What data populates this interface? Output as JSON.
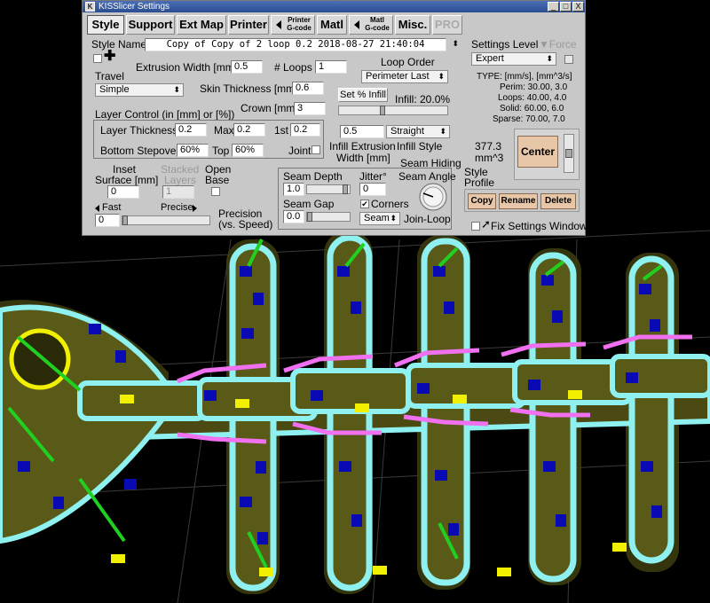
{
  "window": {
    "title": "KISSlicer Settings",
    "minimize_glyph": "_",
    "maximize_glyph": "□",
    "close_glyph": "X"
  },
  "tabs": {
    "style": "Style",
    "support": "Support",
    "ext_map": "Ext Map",
    "printer": "Printer",
    "printer_gcode_1": "Printer",
    "printer_gcode_2": "G-code",
    "matl": "Matl",
    "matl_gcode_1": "Matl",
    "matl_gcode_2": "G-code",
    "misc": "Misc.",
    "pro": "PRO"
  },
  "style": {
    "name_label": "Style Name",
    "name_value": "Copy of Copy of 2 loop 0.2  2018-08-27 21:40:04",
    "extrusion_width_label": "Extrusion Width [mm]",
    "extrusion_width_value": "0.5",
    "loops_label": "# Loops",
    "loops_value": "1",
    "loop_order_label": "Loop Order",
    "loop_order_value": "Perimeter Last",
    "travel_label": "Travel",
    "travel_value": "Simple",
    "skin_thickness_label": "Skin Thickness [mm]",
    "skin_thickness_value": "0.6",
    "set_infill_button": "Set % Infill",
    "infill_label": "Infill: 20.0%",
    "infill_fraction": 0.2,
    "layer_control_label": "Layer Control (in [mm] or [%])",
    "crown_label": "Crown [mm]",
    "crown_value": "3",
    "layer_thickness_label": "Layer Thickness",
    "layer_thickness_value": "0.2",
    "max_label": "Max",
    "max_value": "0.2",
    "first_label": "1st",
    "first_value": "0.2",
    "bottom_stepover_label": "Bottom Stepover",
    "bottom_stepover_value": "60%",
    "top_label": "Top",
    "top_value": "60%",
    "joint_label": "Joint",
    "infill_extrusion_width_label_1": "Infill Extrusion",
    "infill_extrusion_width_label_2": "Width [mm]",
    "infill_extrusion_width_value": "0.5",
    "infill_style_label": "Infill Style",
    "infill_style_value": "Straight",
    "inset_surface_label_1": "Inset",
    "inset_surface_label_2": "Surface [mm]",
    "inset_surface_value": "0",
    "stacked_layers_label_1": "Stacked",
    "stacked_layers_label_2": "Layers",
    "stacked_layers_value": "1",
    "open_base_label_1": "Open",
    "open_base_label_2": "Base",
    "fast_label": "Fast",
    "precise_label": "Precise",
    "precision_value": "0",
    "precision_label_1": "Precision",
    "precision_label_2": "(vs. Speed)",
    "seam_hiding_label": "Seam Hiding",
    "seam_depth_label": "Seam Depth",
    "seam_depth_value": "1.0",
    "jitter_label": "Jitter°",
    "jitter_value": "0",
    "seam_angle_label": "Seam Angle",
    "seam_gap_label": "Seam Gap",
    "seam_gap_value": "0.0",
    "corners_label": "Corners",
    "corners_checked": true,
    "seam_mode_value": "Seam",
    "join_loop_label": "Join-Loop",
    "check_glyph": "✔"
  },
  "settings": {
    "level_label": "Settings Level",
    "force_label": "Force",
    "level_value": "Expert",
    "type_label": "TYPE: [mm/s], [mm^3/s]",
    "perim_line": "Perim:  30.00,  3.0",
    "loops_line": "Loops:  40.00,  4.0",
    "solid_line": "Solid:  60.00,  6.0",
    "sparse_line": "Sparse:  70.00,  7.0",
    "volume_line1": "377.3",
    "volume_line2": "mm^3",
    "center_button": "Center",
    "style_profile_1": "Style",
    "style_profile_2": "Profile",
    "copy_button": "Copy",
    "rename_button": "Rename",
    "delete_button": "Delete",
    "fix_settings_label": "Fix Settings Window"
  },
  "colors": {
    "background": "#000000",
    "window": "#c8c8c8",
    "titlebar": "#2b4c91",
    "outer_shell": "#8ff0f0",
    "part_fill": "#5a5a18",
    "infill_blue": "#0a0ab4",
    "solid_green": "#20d020",
    "seam_yellow": "#f0f000",
    "bridge_magenta": "#f070f0",
    "button_peach": "#e8c6a8"
  }
}
